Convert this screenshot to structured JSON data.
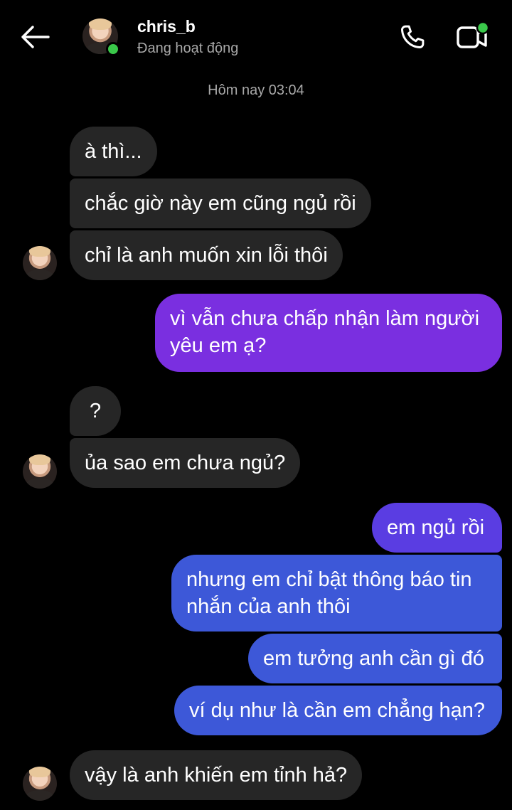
{
  "header": {
    "back_icon": "arrow-left-icon",
    "username": "chris_b",
    "status": "Đang hoạt động",
    "call_icon": "phone-icon",
    "video_icon": "video-camera-icon",
    "online_color": "#3ac84a"
  },
  "conversation": {
    "timestamp": "Hôm nay 03:04",
    "messages": [
      {
        "sender": "them",
        "text": "à thì..."
      },
      {
        "sender": "them",
        "text": "chắc giờ này em cũng ngủ rồi"
      },
      {
        "sender": "them",
        "text": "chỉ là anh muốn xin lỗi thôi"
      },
      {
        "sender": "me",
        "line1": "vì vẫn chưa chấp nhận làm người",
        "line2": "yêu em ạ?"
      },
      {
        "sender": "them",
        "text": "?"
      },
      {
        "sender": "them",
        "text": "ủa sao em chưa ngủ?"
      },
      {
        "sender": "me",
        "text": "em ngủ rồi"
      },
      {
        "sender": "me",
        "line1": "nhưng em chỉ bật thông báo tin",
        "line2": "nhắn của anh thôi"
      },
      {
        "sender": "me",
        "text": "em tưởng anh cần gì đó"
      },
      {
        "sender": "me",
        "text": "ví dụ như là cần em chẳng hạn?"
      },
      {
        "sender": "them",
        "text": "vậy là anh khiến em tỉnh hả?"
      }
    ]
  },
  "colors": {
    "incoming": "#262626",
    "outgoing_purple": "#7a2fe0",
    "outgoing_blue": "#3d58d8"
  }
}
